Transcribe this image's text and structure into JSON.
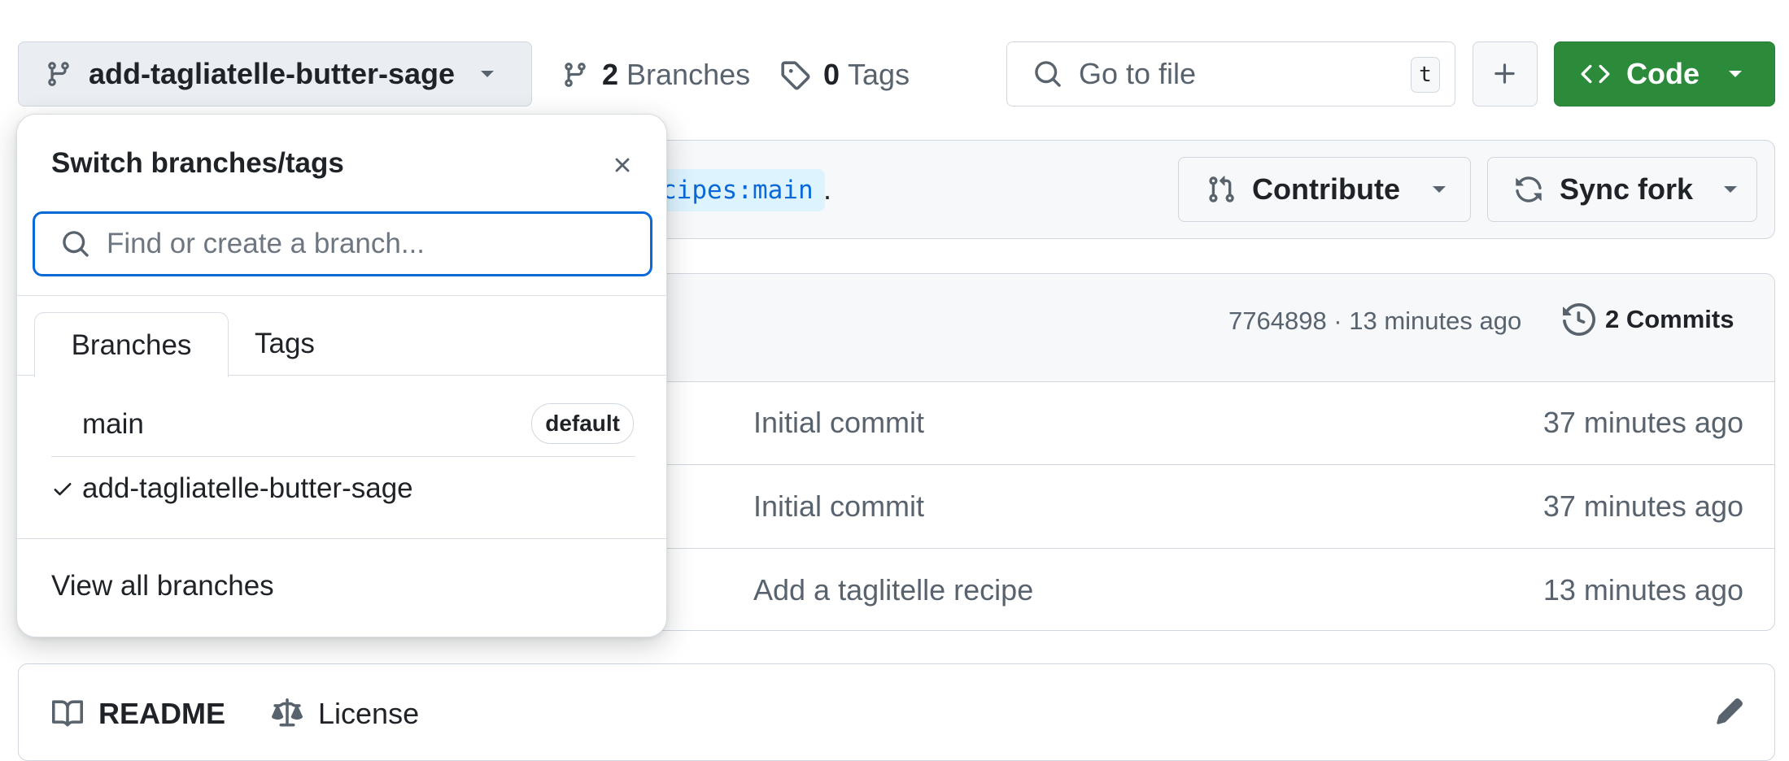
{
  "toolbar": {
    "branch_label": "add-tagliatelle-butter-sage",
    "branches_count": "2",
    "branches_label": "Branches",
    "tags_count": "0",
    "tags_label": "Tags",
    "go_to_file_placeholder": "Go to file",
    "go_to_file_shortcut": "t",
    "code_label": "Code",
    "accent_color": "#2c8a3b"
  },
  "banner": {
    "fork_ref_fragment": "cipes:main",
    "fork_ref_suffix": ".",
    "contribute_label": "Contribute",
    "sync_fork_label": "Sync fork"
  },
  "files": {
    "commit_meta": "7764898 · 13 minutes ago",
    "commits_label": "2 Commits",
    "rows": [
      {
        "message": "Initial commit",
        "time": "37 minutes ago"
      },
      {
        "message": "Initial commit",
        "time": "37 minutes ago"
      },
      {
        "message": "Add a taglitelle recipe",
        "time": "13 minutes ago"
      }
    ]
  },
  "readme": {
    "readme_tab": "README",
    "license_tab": "License"
  },
  "dropdown": {
    "title": "Switch branches/tags",
    "search_placeholder": "Find or create a branch...",
    "tabs": [
      "Branches",
      "Tags"
    ],
    "active_tab": "Branches",
    "branches": [
      {
        "name": "main",
        "badge": "default",
        "selected": false
      },
      {
        "name": "add-tagliatelle-butter-sage",
        "badge": "",
        "selected": true
      }
    ],
    "view_all": "View all branches",
    "focus_color": "#0969da"
  },
  "icons": [
    "git-branch-icon",
    "caret-down-icon",
    "tag-icon",
    "search-icon",
    "plus-icon",
    "code-icon",
    "pull-request-icon",
    "sync-icon",
    "history-icon",
    "book-icon",
    "law-icon",
    "pencil-icon",
    "close-icon",
    "check-icon"
  ]
}
